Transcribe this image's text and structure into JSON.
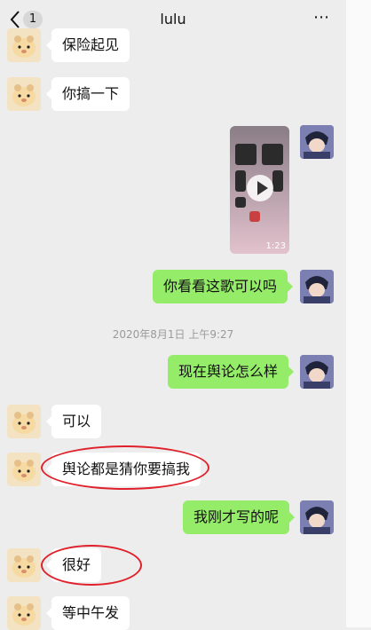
{
  "header": {
    "back_label": "<",
    "unread_count": "1",
    "title": "lulu",
    "more_label": "⋯"
  },
  "messages": [
    {
      "side": "in",
      "text": "保险起见"
    },
    {
      "side": "in",
      "text": "你搞一下"
    },
    {
      "side": "out",
      "type": "video",
      "duration": "1:23"
    },
    {
      "side": "out",
      "text": "你看看这歌可以吗"
    },
    {
      "side": "out",
      "text": "现在舆论怎么样"
    },
    {
      "side": "in",
      "text": "可以"
    },
    {
      "side": "in",
      "text": "舆论都是猜你要搞我",
      "circled": true
    },
    {
      "side": "out",
      "text": "我刚才写的呢"
    },
    {
      "side": "in",
      "text": "很好",
      "circled": true
    },
    {
      "side": "in",
      "text": "等中午发"
    }
  ],
  "timestamp": "2020年8月1日 上午9:27",
  "colors": {
    "background": "#ededed",
    "outgoing_bubble": "#95ec69",
    "incoming_bubble": "#ffffff",
    "annotation": "#e0202a"
  }
}
